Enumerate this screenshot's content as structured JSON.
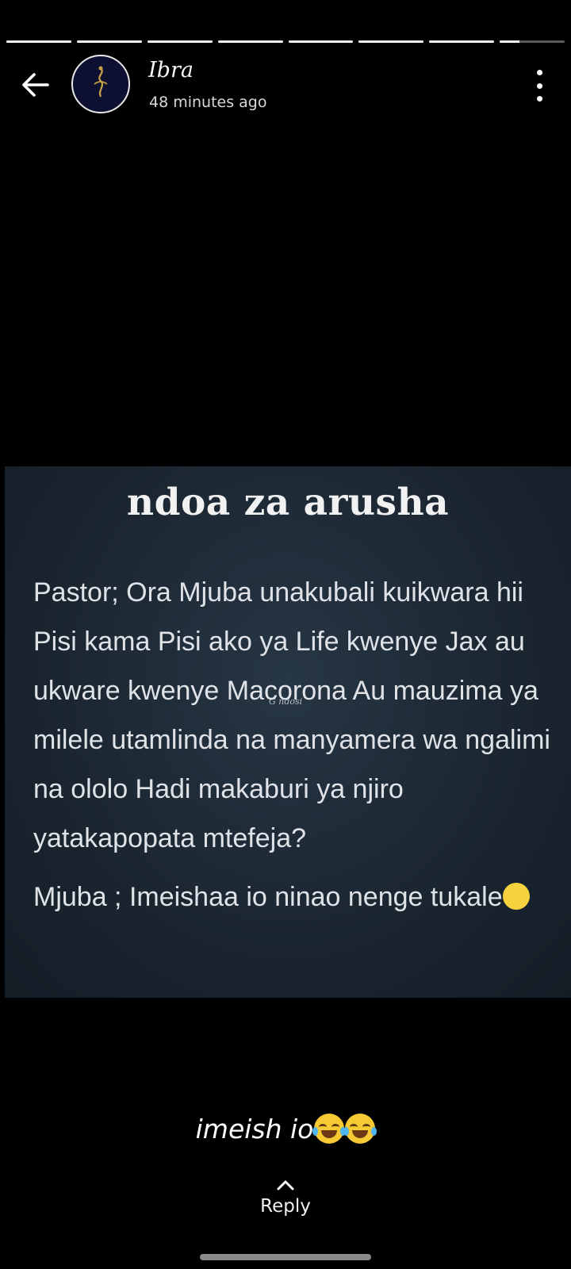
{
  "story": {
    "segments": [
      1,
      1,
      1,
      1,
      1,
      1,
      1,
      0.3
    ],
    "author_name": "Ibra",
    "timestamp": "48 minutes ago",
    "caption_text": "imeish io",
    "caption_emoji": "face-with-tears-of-joy",
    "reply_label": "Reply"
  },
  "post_image": {
    "title": "ndoa za arusha",
    "paragraph_1": "Pastor; Ora Mjuba  unakubali kuikwara hii Pisi kama Pisi ako ya Life    kwenye Jax au ukware kwenye Macorona Au mauzima  ya milele utamlinda na manyamera wa ngalimi na ololo Hadi makaburi ya njiro yatakapopata mtefeja?",
    "paragraph_2": "Mjuba ; Imeishaa io ninao nenge tukale",
    "watermark": "G ndosi"
  },
  "colors": {
    "background": "#000000",
    "post_bg": "#1a2530",
    "progress_active": "#f2f2f2",
    "progress_inactive": "#5a5a5a"
  }
}
